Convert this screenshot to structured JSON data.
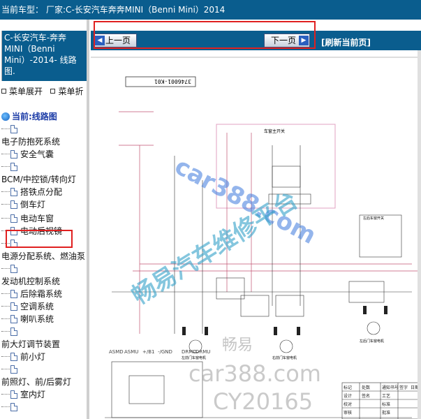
{
  "header": {
    "model_label": "当前车型：",
    "manufacturer": "厂家:C-长安汽车奔奔MINI（Benni Mini）2014"
  },
  "sidebar": {
    "car_title": "C-长安汽车-奔奔MINI（Benni Mini）-2014- 线路图.",
    "menu_expand": "菜单展开",
    "menu_collapse": "菜单折",
    "current": "当前:线路图",
    "items": [
      {
        "label": ""
      },
      {
        "label": "电子防抱死系统"
      },
      {
        "label": "安全气囊"
      },
      {
        "label": ""
      },
      {
        "label": "BCM/中控锁/转向灯"
      },
      {
        "label": "搭铁点分配"
      },
      {
        "label": "倒车灯"
      },
      {
        "label": "电动车窗"
      },
      {
        "label": "电动后视镜"
      },
      {
        "label": ""
      },
      {
        "label": "电源分配系统、燃油泵"
      },
      {
        "label": ""
      },
      {
        "label": "发动机控制系统"
      },
      {
        "label": "后除霜系统"
      },
      {
        "label": "空调系统"
      },
      {
        "label": "喇叭系统"
      },
      {
        "label": ""
      },
      {
        "label": "前大灯调节装置"
      },
      {
        "label": "前小灯"
      },
      {
        "label": ""
      },
      {
        "label": "前照灯、前/后雾灯"
      },
      {
        "label": "室内灯"
      },
      {
        "label": ""
      }
    ]
  },
  "toolbar": {
    "prev_label": "上一页",
    "next_label": "下一页",
    "refresh_label": "[刷新当前页]"
  },
  "diagram": {
    "part_number": "3746001-K01",
    "switch_title": "车窗主开关",
    "right_switch": "左后车窗开关",
    "motor_left": "左前门车窗电机",
    "motor_right": "左后门车窗电机",
    "motor_mid": "右前门车窗电机",
    "connector_labels": [
      "ASMD",
      "ASMU",
      "+/B1",
      "-/GND",
      "DRMD",
      "DRMU"
    ],
    "table_labels": [
      "标记",
      "处数",
      "通知书号",
      "签字",
      "日期",
      "设计",
      "工艺",
      "校对",
      "标准",
      "审核",
      "批准",
      "签名"
    ]
  },
  "watermarks": [
    "car388.com",
    "畅易汽车维修平台",
    "畅易",
    "car388.com",
    "CY20165"
  ]
}
